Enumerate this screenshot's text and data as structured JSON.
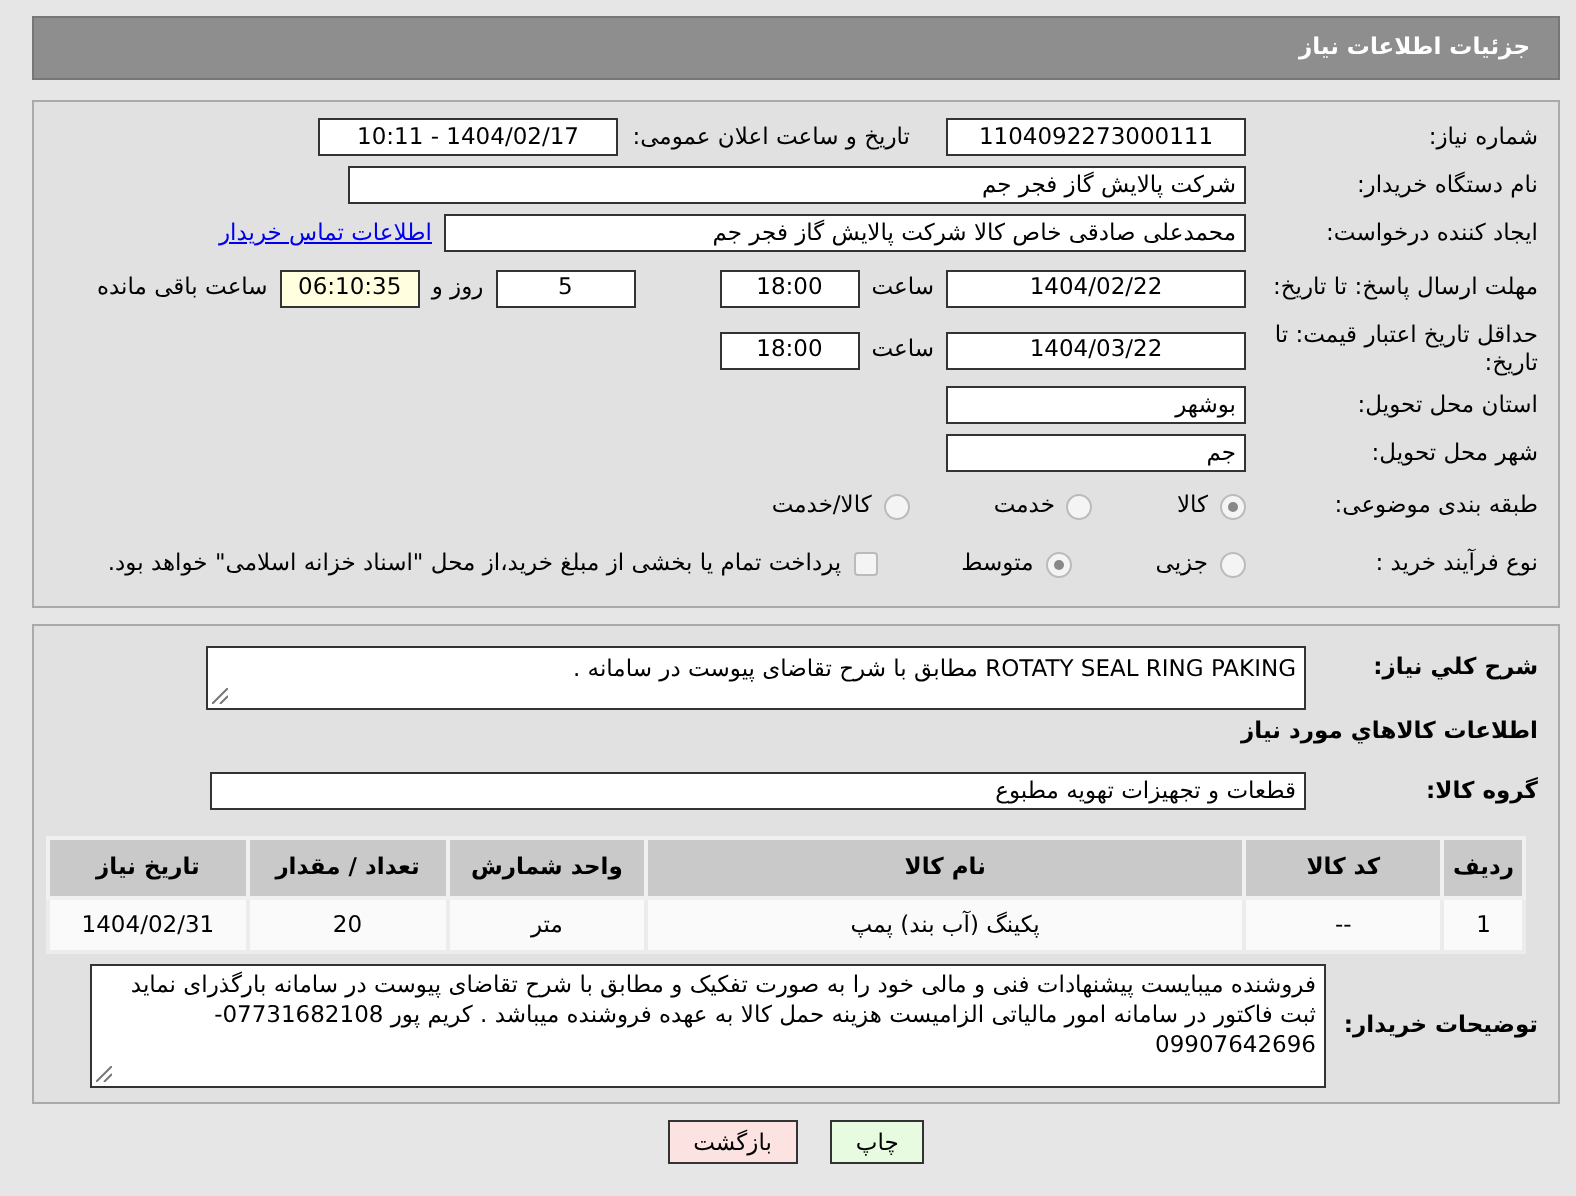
{
  "header": {
    "title": "جزئیات اطلاعات نیاز"
  },
  "need_number": {
    "label": "شماره نیاز:",
    "value": "1104092273000111"
  },
  "announce": {
    "label": "تاریخ و ساعت اعلان عمومی:",
    "value": "1404/02/17 - 10:11"
  },
  "buyer_org": {
    "label": "نام دستگاه خریدار:",
    "value": "شرکت پالایش گاز فجر جم"
  },
  "requester": {
    "label": "ایجاد کننده درخواست:",
    "value": "محمدعلی صادقی خاص کالا شرکت پالایش گاز فجر جم",
    "link": "اطلاعات تماس خریدار"
  },
  "reply_deadline": {
    "label": "مهلت ارسال پاسخ: تا تاریخ:",
    "date": "1404/02/22",
    "time_label": "ساعت",
    "time": "18:00",
    "days": "5",
    "days_label": "روز و",
    "remaining": "06:10:35",
    "remaining_label": "ساعت باقی مانده"
  },
  "price_validity": {
    "label": "حداقل تاریخ اعتبار قیمت: تا تاریخ:",
    "date": "1404/03/22",
    "time_label": "ساعت",
    "time": "18:00"
  },
  "province": {
    "label": "استان محل تحویل:",
    "value": "بوشهر"
  },
  "city": {
    "label": "شهر محل تحویل:",
    "value": "جم"
  },
  "category": {
    "label": "طبقه بندی موضوعی:",
    "options": [
      {
        "label": "کالا",
        "selected": true
      },
      {
        "label": "خدمت",
        "selected": false
      },
      {
        "label": "کالا/خدمت",
        "selected": false
      }
    ]
  },
  "process": {
    "label": "نوع فرآیند خرید :",
    "options": [
      {
        "label": "جزیی",
        "selected": false
      },
      {
        "label": "متوسط",
        "selected": true
      }
    ],
    "payment": {
      "label": "پرداخت تمام یا بخشی از مبلغ خرید،از محل \"اسناد خزانه اسلامی\" خواهد بود.",
      "checked": false
    }
  },
  "description": {
    "label": "شرح کلي نياز:",
    "value": "ROTATY SEAL RING PAKING مطابق با شرح تقاضای پیوست در سامانه ."
  },
  "items_title": "اطلاعات كالاهاي مورد نياز",
  "goods_group": {
    "label": "گروه کالا:",
    "value": "قطعات و تجهیزات تهویه مطبوع"
  },
  "table": {
    "columns": [
      "ردیف",
      "کد کالا",
      "نام کالا",
      "واحد شمارش",
      "تعداد / مقدار",
      "تاریخ نیاز"
    ],
    "rows": [
      [
        "1",
        "--",
        "پکینگ (آب بند) پمپ",
        "متر",
        "20",
        "1404/02/31"
      ]
    ]
  },
  "buyer_notes": {
    "label": "توضیحات خریدار:",
    "value": "فروشنده میبایست پیشنهادات فنی و مالی خود را به صورت تفکیک و مطابق با شرح تقاضای پیوست در سامانه بارگذرای نماید ثبت فاکتور در سامانه امور مالیاتی الزامیست هزینه حمل کالا به عهده فروشنده میباشد . کریم پور 07731682108-09907642696"
  },
  "buttons": [
    {
      "label": "چاپ",
      "kind": "print"
    },
    {
      "label": "بازگشت",
      "kind": "back"
    }
  ]
}
